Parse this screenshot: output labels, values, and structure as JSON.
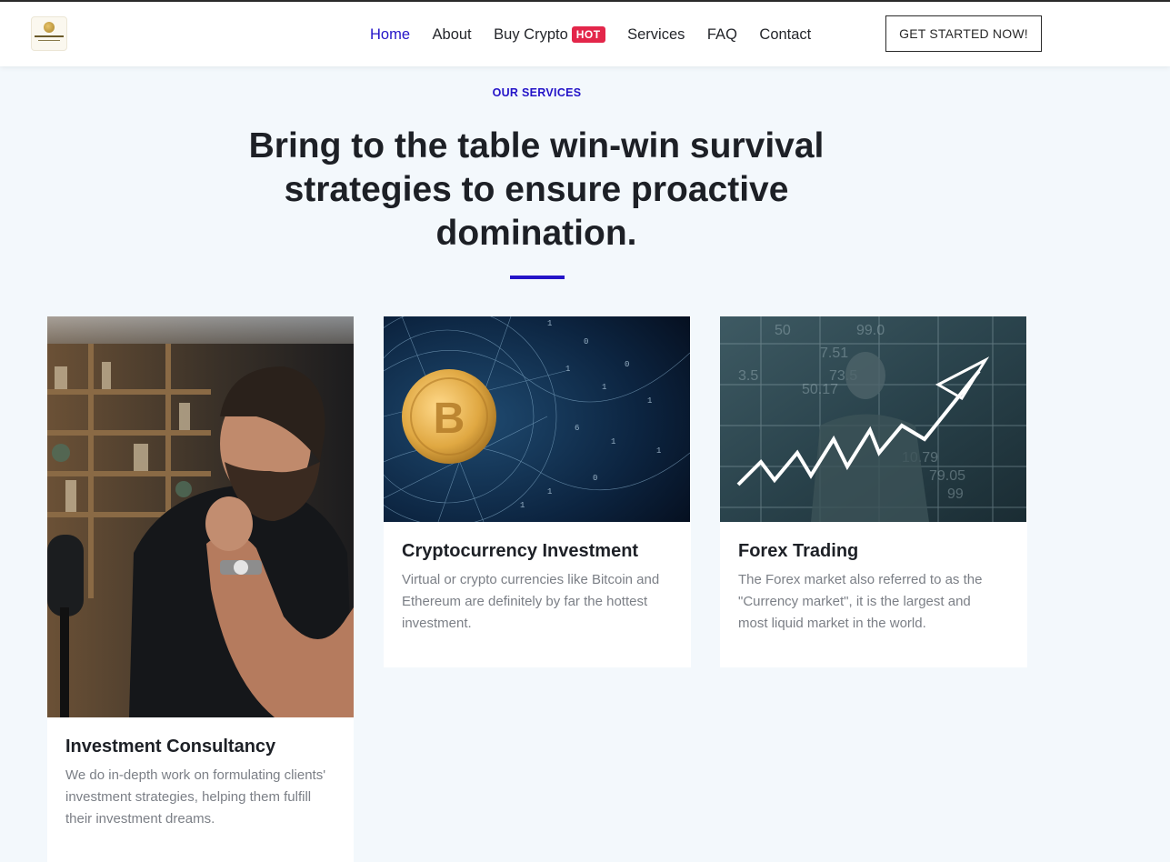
{
  "header": {
    "logo_alt": "Crypto Gains Investment",
    "nav": [
      {
        "label": "Home"
      },
      {
        "label": "About"
      },
      {
        "label": "Buy Crypto",
        "badge": "HOT"
      },
      {
        "label": "Services"
      },
      {
        "label": "FAQ"
      },
      {
        "label": "Contact"
      }
    ],
    "cta_label": "GET STARTED NOW!"
  },
  "services": {
    "eyebrow": "OUR SERVICES",
    "heading": "Bring to the table win-win survival strategies to ensure proactive domination.",
    "cards": [
      {
        "title": "Investment Consultancy",
        "text": "We do in-depth work on formulating clients' investment strategies, helping them fulfill their investment dreams.",
        "image": "man-with-beard-photo"
      },
      {
        "title": "Cryptocurrency Investment",
        "text": "Virtual or crypto currencies like Bitcoin and Ethereum are definitely by far the hottest investment.",
        "image": "bitcoin-coin-photo"
      },
      {
        "title": "Forex Trading",
        "text": "The Forex market also referred to as the \"Currency market\", it is the largest and most liquid market in the world.",
        "image": "forex-chart-arrow-photo"
      }
    ]
  },
  "colors": {
    "accent": "#2414c8",
    "hot_badge": "#e3264a",
    "page_bg": "#f3f8fc"
  }
}
